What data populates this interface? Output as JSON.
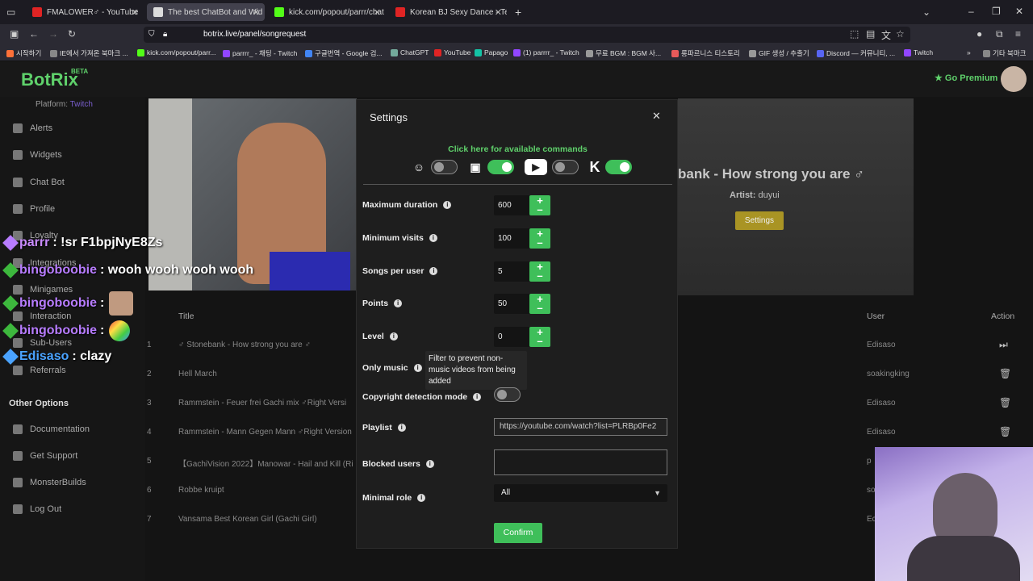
{
  "browser": {
    "tabs": [
      {
        "label": "FMALOWER♂ - YouTube",
        "color": "#e02424"
      },
      {
        "label": "The best ChatBot and Wid",
        "color": "#dddddd"
      },
      {
        "label": "kick.com/popout/parrr/chat",
        "color": "#53fc18"
      },
      {
        "label": "Korean BJ Sexy Dance - Termin",
        "color": "#e02424"
      }
    ],
    "url": "botrix.live/panel/songrequest",
    "bookmarks": [
      {
        "label": "시작하기",
        "color": "#ff7139"
      },
      {
        "label": "IE에서 가져온 북마크 ...",
        "color": "#888888"
      },
      {
        "label": "kick.com/popout/parr...",
        "color": "#53fc18"
      },
      {
        "label": "parrrr_ - 채팅 - Twitch",
        "color": "#9146ff"
      },
      {
        "label": "구글번역 - Google 검...",
        "color": "#4285f4"
      },
      {
        "label": "ChatGPT",
        "color": "#74aa9c"
      },
      {
        "label": "YouTube",
        "color": "#e02424"
      },
      {
        "label": "Papago",
        "color": "#14c3a6"
      },
      {
        "label": "(1) parrrr_ - Twitch",
        "color": "#9146ff"
      },
      {
        "label": "무료 BGM : BGM 사...",
        "color": "#999999"
      },
      {
        "label": "롱파르니스 티스토리",
        "color": "#e85a5a"
      },
      {
        "label": "GIF 생성 / 추출기",
        "color": "#999999"
      },
      {
        "label": "Discord — 커뮤니티, ...",
        "color": "#5865f2"
      },
      {
        "label": "Twitch",
        "color": "#9146ff"
      }
    ],
    "other_bookmarks": "기타 북마크"
  },
  "header": {
    "logo": "BotRix",
    "beta": "BETA",
    "premium": "Go Premium"
  },
  "sidebar": {
    "platform_label": "Platform:",
    "platform_value": "Twitch",
    "items": [
      "Alerts",
      "Widgets",
      "Chat Bot",
      "Profile",
      "Loyalty",
      "Integrations",
      "Minigames",
      "Interaction",
      "Sub-Users",
      "Referrals"
    ],
    "other_title": "Other Options",
    "other_items": [
      "Documentation",
      "Get Support",
      "MonsterBuilds",
      "Log Out"
    ]
  },
  "now_playing": {
    "title": "bank - How strong you are ♂",
    "artist_label": "Artist:",
    "artist": "duyui",
    "settings_button": "Settings"
  },
  "table": {
    "headers": {
      "title": "Title",
      "user": "User",
      "action": "Action"
    },
    "rows": [
      {
        "num": "1",
        "title": "♂ Stonebank - How strong you are ♂",
        "user": "Edisaso",
        "action": "play"
      },
      {
        "num": "2",
        "title": "Hell March",
        "user": "soakingking",
        "action": "delete"
      },
      {
        "num": "3",
        "title": "Rammstein - Feuer frei Gachi mix ♂Right Versi",
        "user": "Edisaso",
        "action": "delete"
      },
      {
        "num": "4",
        "title": "Rammstein - Mann Gegen Mann ♂Right Version",
        "user": "Edisaso",
        "action": "delete"
      },
      {
        "num": "5",
        "title": "【GachiVision 2022】Manowar - Hail and Kill (Ri",
        "user": "p",
        "action": ""
      },
      {
        "num": "6",
        "title": "Robbe kruipt",
        "user": "so",
        "action": ""
      },
      {
        "num": "7",
        "title": "Vansama Best Korean Girl (Gachi Girl)",
        "user": "Ec",
        "action": ""
      }
    ]
  },
  "chat": [
    {
      "user": "parrr",
      "msg": ": !sr F1bpjNyE8Zs",
      "color": "#c98bff"
    },
    {
      "user": "bingoboobie",
      "msg": ": wooh wooh wooh wooh",
      "color": "#b77cff"
    },
    {
      "user": "bingoboobie",
      "msg": ":",
      "color": "#b77cff"
    },
    {
      "user": "bingoboobie",
      "msg": ":",
      "color": "#b77cff"
    },
    {
      "user": "Edisaso",
      "msg": ": clazy",
      "color": "#4aa3ff"
    }
  ],
  "modal": {
    "title": "Settings",
    "commands_link": "Click here for available commands",
    "platforms": [
      {
        "name": "kick-alt",
        "icon": "☺",
        "enabled": false
      },
      {
        "name": "twitch",
        "icon": "▣",
        "enabled": true
      },
      {
        "name": "youtube",
        "icon": "▶",
        "enabled": false
      },
      {
        "name": "kick",
        "icon": "K",
        "enabled": true
      }
    ],
    "fields": {
      "max_duration": {
        "label": "Maximum duration",
        "value": "600"
      },
      "min_visits": {
        "label": "Minimum visits",
        "value": "100"
      },
      "songs_per_user": {
        "label": "Songs per user",
        "value": "5"
      },
      "points": {
        "label": "Points",
        "value": "50"
      },
      "level": {
        "label": "Level",
        "value": "0"
      },
      "only_music": {
        "label": "Only music"
      },
      "copyright": {
        "label": "Copyright detection mode",
        "enabled": false
      },
      "playlist": {
        "label": "Playlist",
        "value": "https://youtube.com/watch?list=PLRBp0Fe2"
      },
      "blocked_users": {
        "label": "Blocked users",
        "value": ""
      },
      "minimal_role": {
        "label": "Minimal role",
        "value": "All"
      }
    },
    "tooltip": "Filter to prevent non-music videos from being added",
    "confirm": "Confirm"
  },
  "colors": {
    "accent": "#3fbf5a",
    "brand": "#5fd16b",
    "twitch_purple": "#9146ff"
  }
}
